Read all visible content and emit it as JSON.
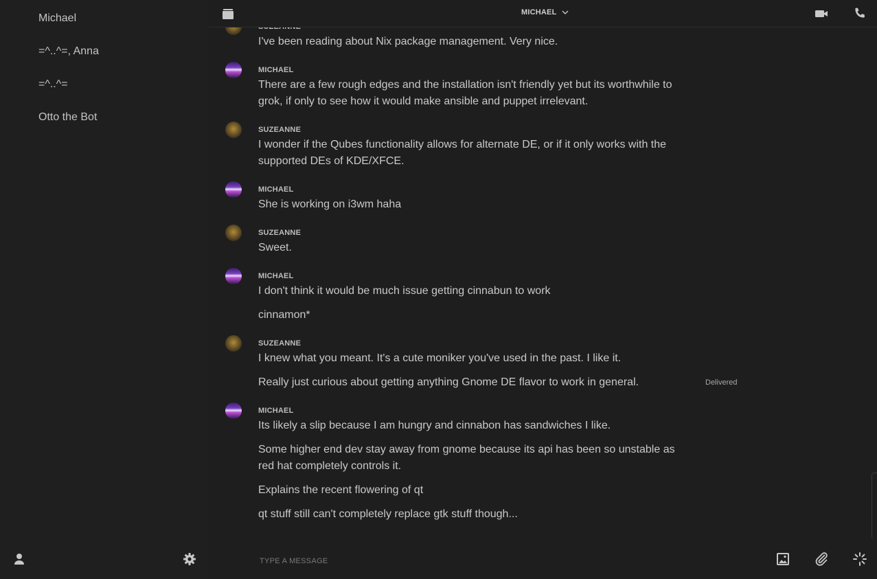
{
  "sidebar": {
    "conversations": [
      {
        "label": "Michael"
      },
      {
        "label": "=^..^=, Anna"
      },
      {
        "label": "=^..^="
      },
      {
        "label": "Otto the Bot"
      }
    ],
    "footer": {
      "profile_icon": "person-icon",
      "settings_icon": "gear-icon"
    }
  },
  "header": {
    "archive_icon": "archive-icon",
    "contact_name": "MICHAEL",
    "dropdown_icon": "chevron-down-icon",
    "video_icon": "video-camera-icon",
    "phone_icon": "phone-icon"
  },
  "conversation": {
    "groups": [
      {
        "sender": "SUZEANNE",
        "messages": [
          "I've been reading about Nix package management. Very nice."
        ]
      },
      {
        "sender": "MICHAEL",
        "messages": [
          "There are a few rough edges and the installation isn't friendly yet but its worthwhile to grok, if only to see how it would make ansible and puppet irrelevant."
        ]
      },
      {
        "sender": "SUZEANNE",
        "messages": [
          "I wonder if the Qubes functionality allows for alternate DE, or if it only works with the supported DEs of KDE/XFCE."
        ]
      },
      {
        "sender": "MICHAEL",
        "messages": [
          "She is working on i3wm haha"
        ]
      },
      {
        "sender": "SUZEANNE",
        "messages": [
          "Sweet."
        ]
      },
      {
        "sender": "MICHAEL",
        "messages": [
          "I don't think it would be much issue getting cinnabun to work",
          "cinnamon*"
        ]
      },
      {
        "sender": "SUZEANNE",
        "messages": [
          "I knew what you meant. It's a cute moniker you've used in the past. I like it.",
          "Really just curious about getting anything Gnome DE flavor to work in general."
        ]
      },
      {
        "sender": "MICHAEL",
        "messages": [
          "Its likely a slip because I am hungry and cinnabon has sandwiches I like.",
          "Some higher end dev stay away from gnome because its api has been so unstable as red hat completely controls it.",
          "Explains the recent flowering of qt",
          "qt stuff still can't completely replace gtk stuff though..."
        ]
      }
    ],
    "delivered_status": "Delivered"
  },
  "composer": {
    "placeholder": "TYPE A MESSAGE",
    "value": "",
    "image_icon": "image-icon",
    "attach_icon": "paperclip-icon",
    "loading_icon": "loading-spinner-icon"
  },
  "colors": {
    "background": "#1e1e1e",
    "text": "#c9c9c9",
    "icon": "#c8c8c8"
  }
}
